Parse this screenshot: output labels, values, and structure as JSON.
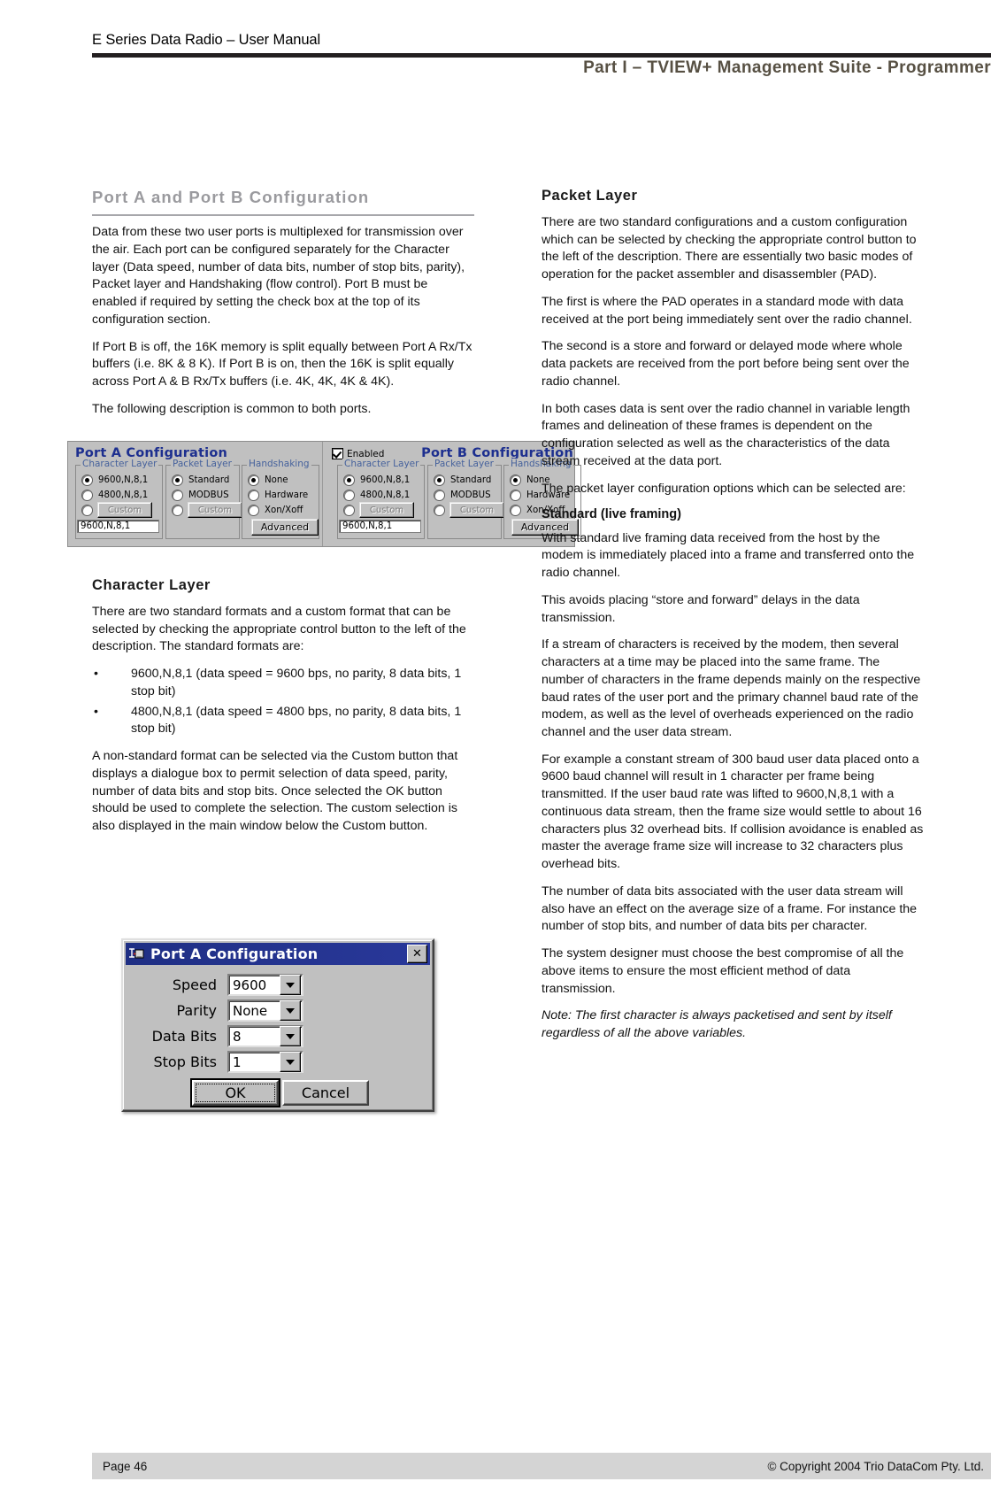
{
  "header": {
    "manual_title": "E Series Data Radio – User Manual",
    "part_title": "Part I – TVIEW+ Management Suite - Programmer"
  },
  "footer": {
    "page_label": "Page 46",
    "copyright": "© Copyright 2004 Trio DataCom Pty. Ltd."
  },
  "left_column": {
    "section_title": "Port A and Port B Configuration",
    "intro_paragraphs": [
      "Data from these two user ports is multiplexed for transmission over the air. Each port can be configured separately for the Character layer (Data speed, number of data bits, number of stop bits, parity), Packet layer and Handshaking (flow control). Port B must be enabled if required by setting the check box at the top of its configuration section.",
      "If Port B is off, the 16K memory is split equally between Port A Rx/Tx buffers (i.e. 8K & 8 K). If Port B is on, then the 16K is split equally across Port A & B Rx/Tx buffers (i.e. 4K, 4K, 4K & 4K).",
      "The following description is common to both ports."
    ],
    "character_layer": {
      "heading": "Character Layer",
      "intro": "There are two standard formats and a custom format that can be selected by checking the appropriate control button to the left of the description. The standard formats are:",
      "bullets": [
        "9600,N,8,1  (data speed = 9600 bps, no parity, 8 data bits, 1 stop bit)",
        "4800,N,8,1  (data speed = 4800 bps, no parity, 8 data bits, 1 stop bit)"
      ],
      "outro": "A non-standard format can be selected via the Custom button that displays a dialogue box to permit selection of data speed, parity, number of data bits and stop bits. Once selected the OK button should be used to complete the selection. The custom selection is also displayed in the main window below the Custom button."
    }
  },
  "right_column": {
    "packet_layer": {
      "heading": "Packet Layer",
      "paragraphs": [
        "There are two standard configurations and a custom configuration which can be selected by checking the appropriate control button to the left of the description. There are essentially two basic modes of operation for the packet assembler and disassembler (PAD).",
        "The first is where the PAD operates in a standard mode with data received at the port being immediately sent over the radio channel.",
        "The second is a store and forward or delayed mode where whole data packets are received from the port before being sent over the radio channel.",
        "In both cases data is sent over the radio channel in variable length frames and delineation of these frames is dependent on the configuration selected as well as the characteristics of the data stream received at the data port.",
        "The packet layer configuration options which can be selected are:"
      ]
    },
    "standard_framing": {
      "heading": "Standard (live framing)",
      "paragraphs": [
        "With standard live framing data received from the host by the modem is immediately placed into a frame and transferred onto the radio channel.",
        " This avoids placing “store and forward” delays in the data transmission.",
        "If a stream of characters is received by the modem, then several characters at a time may be placed into the same frame. The number of characters in the frame depends mainly on the respective baud rates of the user port and the primary channel baud rate of the modem, as well as the level of overheads experienced on the radio channel and the user data stream.",
        "For example a constant stream of 300 baud user data placed onto a 9600 baud channel will result in 1 character per frame being transmitted.  If the user baud rate was lifted to 9600,N,8,1 with a continuous data stream, then the frame size would settle to about 16 characters plus 32 overhead bits.  If collision avoidance is enabled as master the average frame size will increase to 32 characters plus overhead bits.",
        "The number of data bits associated with the user data stream will also have an effect on the average size of a frame.  For instance the number of stop bits, and number of data bits per character.",
        "The system designer must choose the best compromise of all the above items to ensure the most efficient method of data transmission."
      ],
      "note": "Note: The first character is always packetised and sent by itself regardless of all the above variables."
    }
  },
  "figure_ports": {
    "port_a": {
      "title": "Port A Configuration",
      "character_layer": {
        "legend": "Character Layer",
        "options": [
          "9600,N,8,1",
          "4800,N,8,1"
        ],
        "selected_index": 0,
        "custom_button": "Custom",
        "custom_value": "9600,N,8,1"
      },
      "packet_layer": {
        "legend": "Packet Layer",
        "options": [
          "Standard",
          "MODBUS"
        ],
        "selected_index": 0,
        "custom_button": "Custom"
      },
      "handshaking": {
        "legend": "Handshaking",
        "options": [
          "None",
          "Hardware",
          "Xon/Xoff"
        ],
        "selected_index": 0,
        "advanced_button": "Advanced"
      }
    },
    "port_b": {
      "title": "Port B Configuration",
      "enabled_label": "Enabled",
      "enabled_checked": true,
      "character_layer": {
        "legend": "Character Layer",
        "options": [
          "9600,N,8,1",
          "4800,N,8,1"
        ],
        "selected_index": 0,
        "custom_button": "Custom",
        "custom_value": "9600,N,8,1"
      },
      "packet_layer": {
        "legend": "Packet Layer",
        "options": [
          "Standard",
          "MODBUS"
        ],
        "selected_index": 0,
        "custom_button": "Custom"
      },
      "handshaking": {
        "legend": "Handshaking",
        "options": [
          "None",
          "Hardware",
          "Xon/Xoff"
        ],
        "selected_index": 0,
        "advanced_button": "Advanced"
      }
    }
  },
  "dialog_port_a": {
    "title": "Port A Configuration",
    "close_label": "✕",
    "fields": [
      {
        "label": "Speed",
        "value": "9600"
      },
      {
        "label": "Parity",
        "value": "None"
      },
      {
        "label": "Data Bits",
        "value": "8"
      },
      {
        "label": "Stop Bits",
        "value": "1"
      }
    ],
    "ok_button": "OK",
    "cancel_button": "Cancel"
  },
  "colors": {
    "header_rule": "#231f20",
    "part_title": "#575043",
    "section_title": "#9a9a9e",
    "win_face": "#c0c0c0",
    "win_titlebar": "#1f2f84",
    "group_legend": "#45619c",
    "footer_bg": "#d4d4d4"
  }
}
